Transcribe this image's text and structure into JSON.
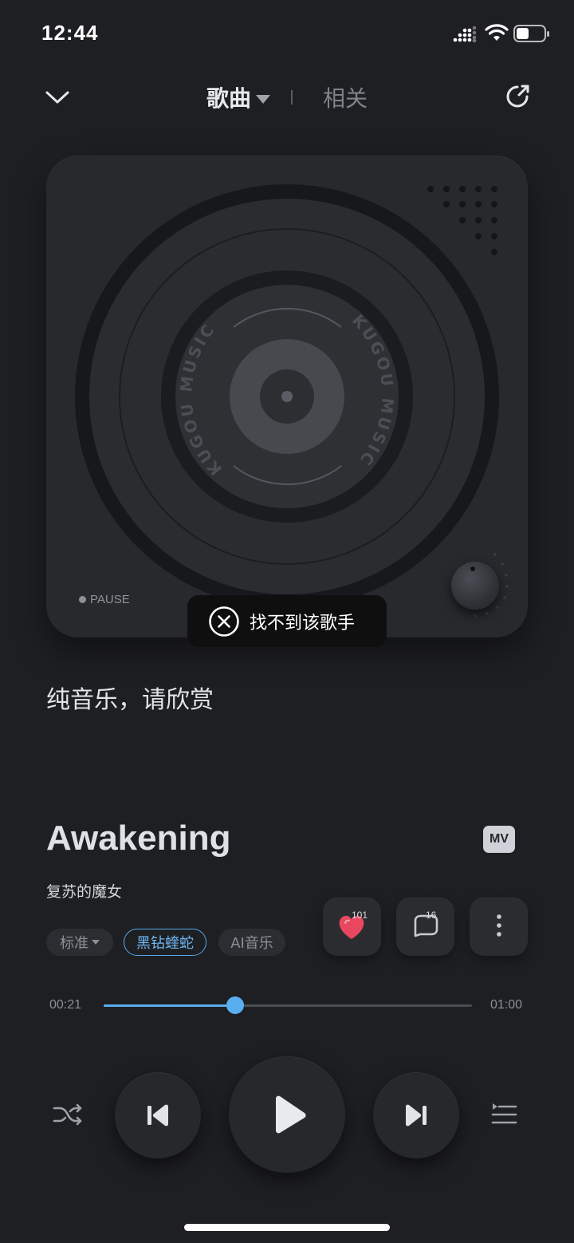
{
  "status": {
    "time": "12:44"
  },
  "header": {
    "tab_song": "歌曲",
    "tab_related": "相关"
  },
  "player": {
    "pause_label": "PAUSE",
    "disc_brand_text": "KUGOU MUSIC"
  },
  "toast": {
    "text": "找不到该歌手",
    "icon": "close-circle-icon"
  },
  "lyric": "纯音乐，请欣赏",
  "song": {
    "title": "Awakening",
    "mv_label": "MV",
    "artist": "复苏的魔女"
  },
  "chips": {
    "quality": "标准",
    "vip": "黑钻蝰蛇",
    "ai": "AI音乐"
  },
  "actions": {
    "like_count": "101",
    "comment_count": "16"
  },
  "progress": {
    "current": "00:21",
    "total": "01:00",
    "fraction": 0.357
  },
  "colors": {
    "accent": "#59aef0",
    "like": "#e8475f",
    "background": "#1e1f22"
  }
}
